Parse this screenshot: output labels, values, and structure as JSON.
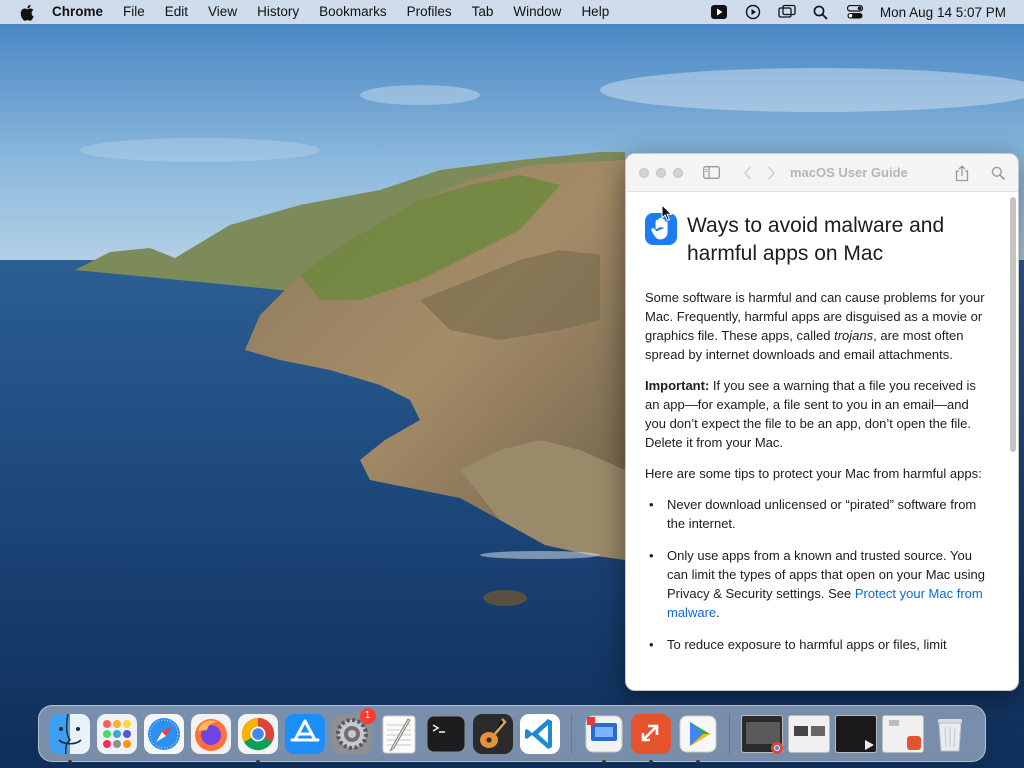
{
  "menubar": {
    "app_name": "Chrome",
    "menus": [
      "File",
      "Edit",
      "View",
      "History",
      "Bookmarks",
      "Profiles",
      "Tab",
      "Window",
      "Help"
    ],
    "clock": "Mon Aug 14  5:07 PM"
  },
  "window": {
    "title": "macOS User Guide",
    "heading": "Ways to avoid malware and harmful apps on Mac",
    "intro_before": "Some software is harmful and can cause problems for your Mac. Frequently, harmful apps are disguised as a movie or graphics file. These apps, called ",
    "intro_em": "trojans",
    "intro_after": ", are most often spread by internet downloads and email attachments.",
    "important_label": "Important:",
    "important_text": " If you see a warning that a file you received is an app—for example, a file sent to you in an email—and you don’t expect the file to be an app, don’t open the file. Delete it from your Mac.",
    "tips_intro": "Here are some tips to protect your Mac from harmful apps:",
    "tip1": "Never download unlicensed or “pirated” software from the internet.",
    "tip2_before": "Only use apps from a known and trusted source. You can limit the types of apps that open on your Mac using Privacy & Security settings. See ",
    "tip2_link": "Protect your Mac from malware",
    "tip2_after": ".",
    "tip3": "To reduce exposure to harmful apps or files, limit"
  },
  "dock": {
    "settings_badge": "1"
  },
  "colors": {
    "link": "#0a6ad6",
    "accent": "#1d7cf2"
  }
}
